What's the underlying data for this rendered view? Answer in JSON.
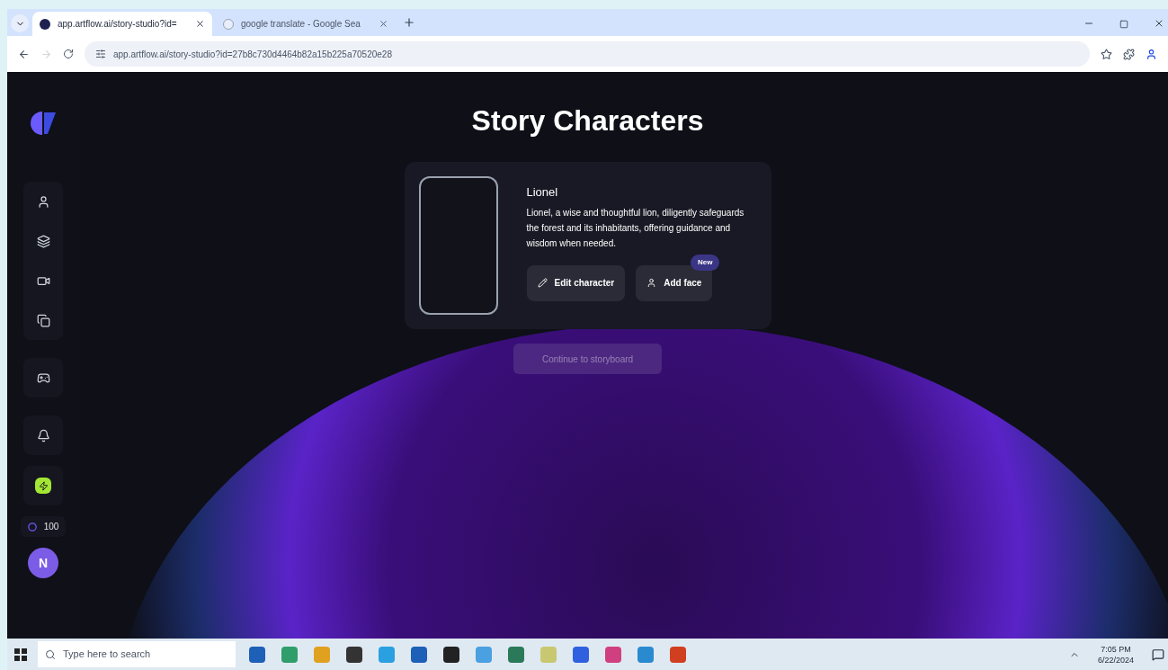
{
  "browser": {
    "tabs": [
      {
        "title": "app.artflow.ai/story-studio?id=",
        "selected": true
      },
      {
        "title": "google translate - Google Sea",
        "selected": false
      }
    ],
    "url": "app.artflow.ai/story-studio?id=27b8c730d4464b82a15b225a70520e28"
  },
  "sidebar": {
    "credits": "100",
    "avatar": "N"
  },
  "page": {
    "title": "Story Characters",
    "character": {
      "name": "Lionel",
      "description": "Lionel, a wise and thoughtful lion, diligently safeguards the forest and its inhabitants, offering guidance and wisdom when needed.",
      "edit_button": "Edit character",
      "face_button": "Add face",
      "badge": "New"
    },
    "continue_button": {
      "label": "Continue to storyboard",
      "disabled": true
    }
  },
  "taskbar": {
    "search_placeholder": "Type here to search",
    "time": "7:05 PM",
    "date": "6/22/2024"
  }
}
